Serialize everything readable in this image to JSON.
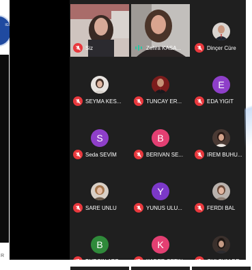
{
  "left_logo_text": "IGI",
  "bottom_left_text": "R",
  "colors": {
    "muted": "#e8383d",
    "speaking": "#2ec6a4",
    "tile": "#1f1f1f"
  },
  "participants": [
    {
      "name": "Siz",
      "type": "video",
      "muted": true
    },
    {
      "name": "Zehra KASA...",
      "type": "video",
      "speaking": true
    },
    {
      "name": "Dinçer Cüre",
      "type": "photo",
      "muted": true
    },
    {
      "name": "SEYMA KES...",
      "type": "photo",
      "muted": true
    },
    {
      "name": "TUNCAY ER...",
      "type": "photo",
      "muted": true
    },
    {
      "name": "EDA YIGIT",
      "type": "letter",
      "letter": "E",
      "color": "#8e3fc9",
      "muted": true
    },
    {
      "name": "Seda SEVİM",
      "type": "letter",
      "letter": "S",
      "color": "#8e3fc9",
      "muted": true
    },
    {
      "name": "BERIVAN SE...",
      "type": "letter",
      "letter": "B",
      "color": "#e33f72",
      "muted": true
    },
    {
      "name": "IREM BUHU...",
      "type": "photo",
      "muted": true
    },
    {
      "name": "SARE UNLU",
      "type": "photo",
      "muted": true
    },
    {
      "name": "YUNUS ULU...",
      "type": "letter",
      "letter": "Y",
      "color": "#7b38c8",
      "muted": true
    },
    {
      "name": "FERDI BAL",
      "type": "photo",
      "muted": true
    },
    {
      "name": "BURCIN ARB...",
      "type": "letter",
      "letter": "B",
      "color": "#2f8a3a",
      "muted": true
    },
    {
      "name": "KADER CETIN",
      "type": "letter",
      "letter": "K",
      "color": "#e33f72",
      "muted": true
    },
    {
      "name": "GULSUM DE...",
      "type": "photo",
      "muted": true
    }
  ]
}
